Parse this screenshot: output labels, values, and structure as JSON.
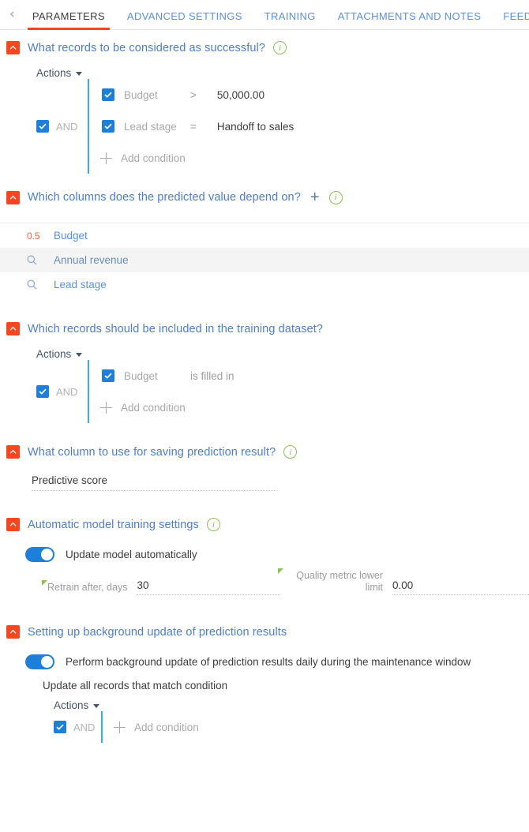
{
  "tabs": {
    "prev_arrow": "‹",
    "next_arrow": "›",
    "items": [
      {
        "label": "PARAMETERS",
        "active": true
      },
      {
        "label": "ADVANCED SETTINGS",
        "active": false
      },
      {
        "label": "TRAINING",
        "active": false
      },
      {
        "label": "ATTACHMENTS AND NOTES",
        "active": false
      },
      {
        "label": "FEED",
        "active": false
      }
    ]
  },
  "colors": {
    "accent_orange": "#f4471f",
    "link_blue": "#5b8fe0",
    "title_blue": "#4d7ec8",
    "checkbox_blue": "#1d7fd8",
    "tree_line_blue": "#3fa9e5",
    "info_green": "#8cc152",
    "weight_orange": "#f4603a"
  },
  "sections": {
    "successful": {
      "title": "What records to be considered as successful?",
      "actions_label": "Actions",
      "and_label": "AND",
      "conditions": [
        {
          "name": "Budget",
          "operator": ">",
          "value": "50,000.00"
        },
        {
          "name": "Lead stage",
          "operator": "=",
          "value": "Handoff to sales"
        }
      ],
      "add_condition_label": "Add condition"
    },
    "columns": {
      "title": "Which columns does the predicted value depend on?",
      "rows": [
        {
          "weight": "0.5",
          "name": "Budget",
          "icon": "none",
          "highlighted": false
        },
        {
          "weight": "",
          "name": "Annual revenue",
          "icon": "search-icon",
          "highlighted": true
        },
        {
          "weight": "",
          "name": "Lead stage",
          "icon": "search-icon",
          "highlighted": false
        }
      ]
    },
    "training_dataset": {
      "title": "Which records should be included in the training dataset?",
      "actions_label": "Actions",
      "and_label": "AND",
      "conditions": [
        {
          "name": "Budget",
          "operator": "is filled in",
          "value": ""
        }
      ],
      "add_condition_label": "Add condition"
    },
    "saving_column": {
      "title": "What column to use for saving prediction result?",
      "value": "Predictive score"
    },
    "auto_training": {
      "title": "Automatic model training settings",
      "toggle_label": "Update model automatically",
      "retrain_label": "Retrain after, days",
      "retrain_value": "30",
      "quality_label": "Quality metric lower limit",
      "quality_value": "0.00"
    },
    "background_update": {
      "title": "Setting up background update of prediction results",
      "toggle_label": "Perform background update of prediction results daily during the maintenance window",
      "match_label": "Update all records that match condition",
      "actions_label": "Actions",
      "and_label": "AND",
      "add_condition_label": "Add condition"
    }
  }
}
